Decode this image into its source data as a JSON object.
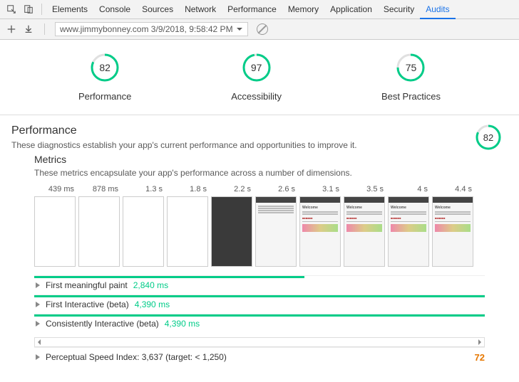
{
  "tabs": {
    "elements": "Elements",
    "console": "Console",
    "sources": "Sources",
    "network": "Network",
    "performance": "Performance",
    "memory": "Memory",
    "application": "Application",
    "security": "Security",
    "audits": "Audits"
  },
  "url": "www.jimmybonney.com 3/9/2018, 9:58:42 PM",
  "scores": {
    "performance": {
      "value": "82",
      "label": "Performance",
      "pct": 82,
      "color": "#0c8"
    },
    "accessibility": {
      "value": "97",
      "label": "Accessibility",
      "pct": 97,
      "color": "#0c8"
    },
    "bestpractices": {
      "value": "75",
      "label": "Best Practices",
      "pct": 75,
      "color": "#0c8"
    }
  },
  "perf": {
    "title": "Performance",
    "sub": "These diagnostics establish your app's current performance and opportunities to improve it.",
    "ring": "82"
  },
  "metrics": {
    "title": "Metrics",
    "sub": "These metrics encapsulate your app's performance across a number of dimensions.",
    "times": [
      "439 ms",
      "878 ms",
      "1.3 s",
      "1.8 s",
      "2.2 s",
      "2.6 s",
      "3.1 s",
      "3.5 s",
      "4 s",
      "4.4 s"
    ],
    "rows": [
      {
        "name": "First meaningful paint",
        "val": "2,840 ms",
        "color": "#0c8",
        "bar": 60,
        "score": ""
      },
      {
        "name": "First Interactive (beta)",
        "val": "4,390 ms",
        "color": "#0c8",
        "bar": 100,
        "score": ""
      },
      {
        "name": "Consistently Interactive (beta)",
        "val": "4,390 ms",
        "color": "#0c8",
        "bar": 100,
        "score": ""
      },
      {
        "name": "Perceptual Speed Index: 3,637 (target: < 1,250)",
        "val": "",
        "color": "",
        "bar": 0,
        "score": "72",
        "scolor": "#e67700"
      }
    ]
  }
}
